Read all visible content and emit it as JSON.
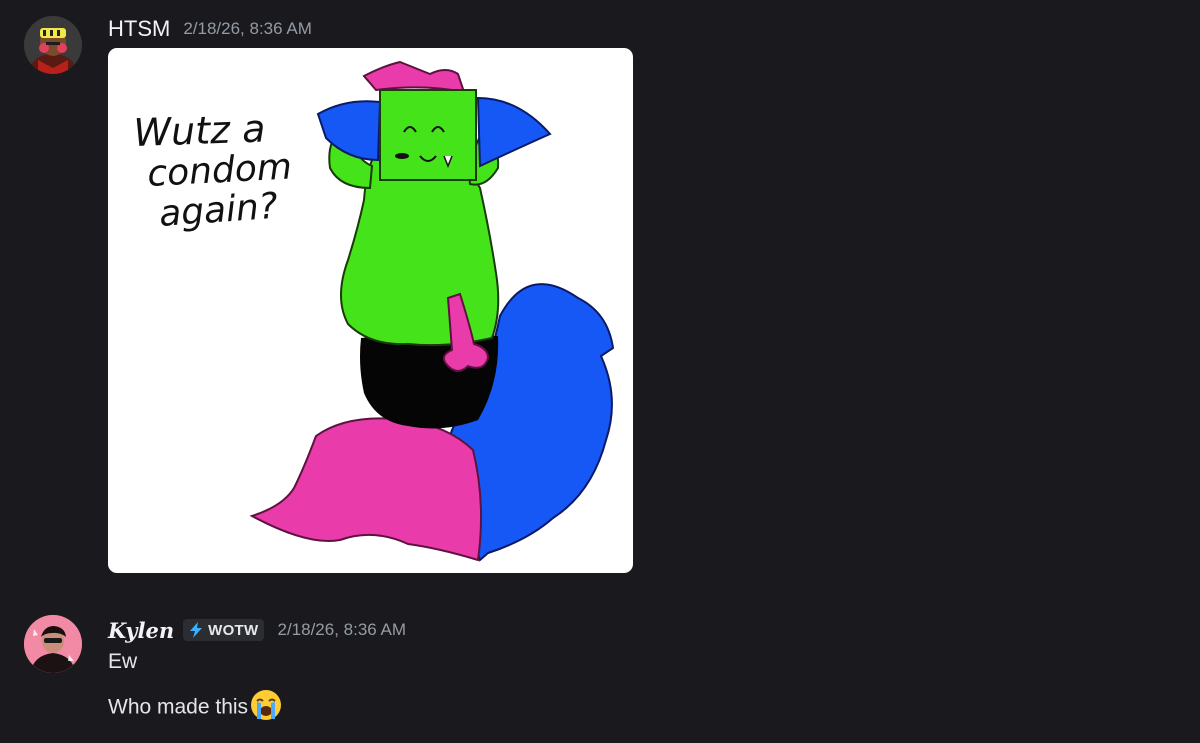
{
  "messages": [
    {
      "username": "HTSM",
      "timestamp": "2/18/26, 8:36 AM",
      "attachment": {
        "caption_text": [
          "Wutz a",
          "condom",
          "again?"
        ]
      }
    },
    {
      "username": "Kylen",
      "tag": {
        "icon": "lightning-icon",
        "label": "WOTW"
      },
      "timestamp": "2/18/26, 8:36 AM",
      "lines": [
        "Ew",
        "Who made this"
      ],
      "trailing_emoji": "loudly-crying-face-emoji"
    }
  ],
  "colors": {
    "background": "#1a1a1e",
    "username": "#f2f3f5",
    "timestamp": "#949ba4",
    "tag_background": "#2b2d31",
    "tag_icon": "#3ab0ff",
    "character_green": "#45e31a",
    "character_blue": "#1658f5",
    "character_pink": "#ea3bab"
  }
}
